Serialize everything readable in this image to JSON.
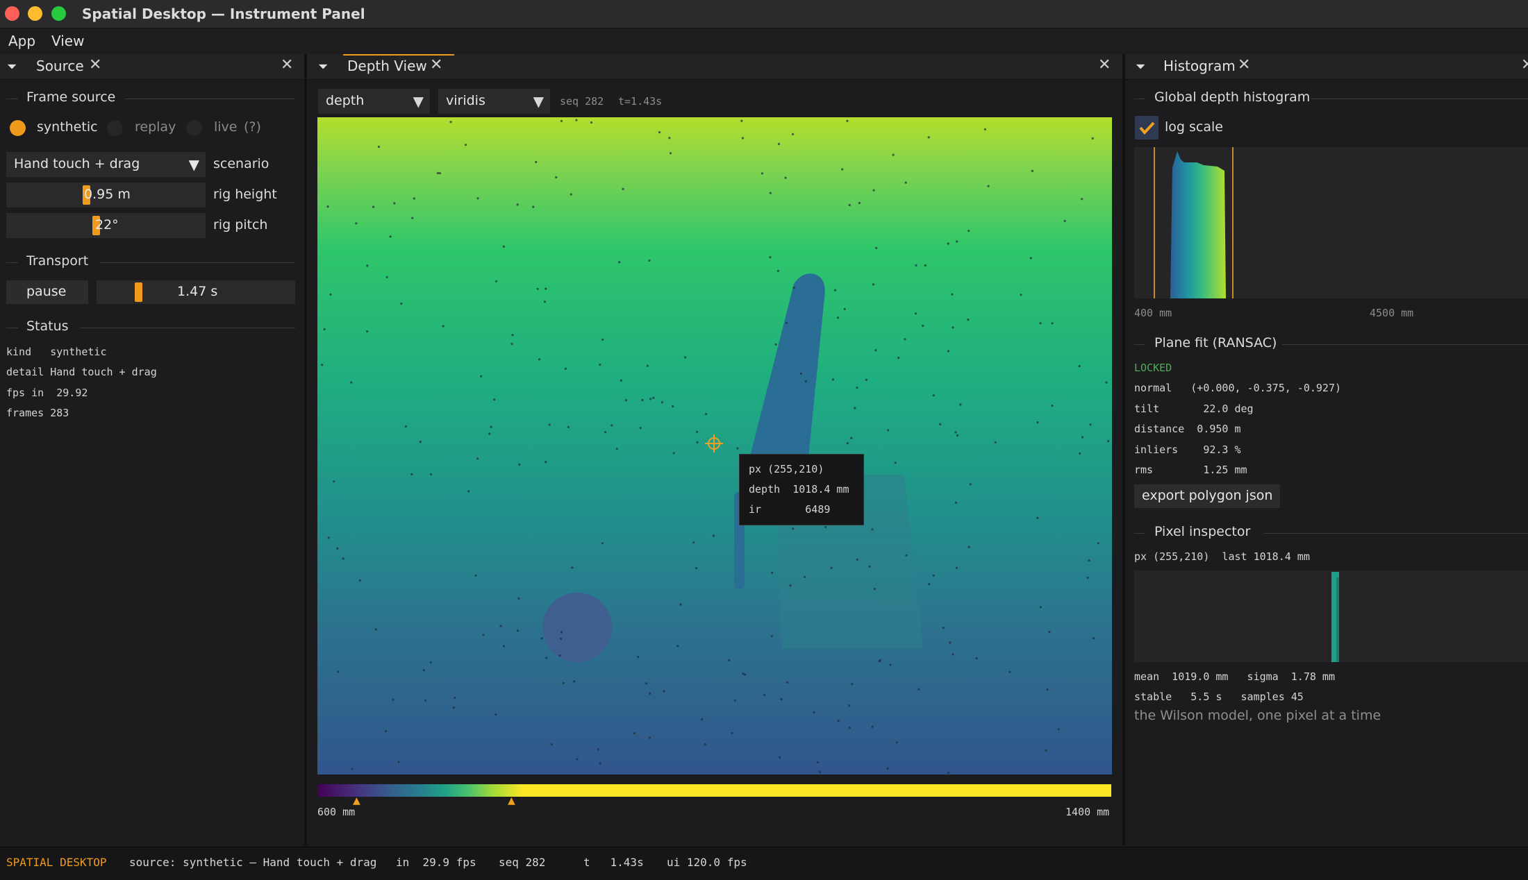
{
  "window": {
    "title": "Spatial Desktop — Instrument Panel"
  },
  "menu": [
    "App",
    "View"
  ],
  "source_panel": {
    "tab": "Source",
    "frame_source": {
      "title": "Frame source",
      "options": [
        "synthetic",
        "replay",
        "live"
      ],
      "selected": "synthetic",
      "help": "(?)"
    },
    "scenario": {
      "value": "Hand touch + drag",
      "label": "scenario"
    },
    "rig_height": {
      "value": "0.95 m",
      "label": "rig height",
      "fraction": 0.4
    },
    "rig_pitch": {
      "value": "22°",
      "label": "rig pitch",
      "fraction": 0.45
    },
    "transport": {
      "title": "Transport",
      "button": "pause",
      "time": "1.47 s",
      "fraction": 0.2
    },
    "status": {
      "title": "Status",
      "rows": [
        "kind   synthetic",
        "detail Hand touch + drag",
        "fps in  29.92",
        "frames 283"
      ]
    }
  },
  "depth_panel": {
    "tab": "Depth View",
    "mode": "depth",
    "colormap": "viridis",
    "seq": "seq 282",
    "t": "t=1.43s",
    "colorbar": {
      "min_label": "600 mm",
      "max_label": "1400 mm",
      "marker_low": 0.05,
      "marker_high": 0.245
    },
    "tooltip": {
      "px": "px (255,210)",
      "depth": "depth  1018.4 mm",
      "ir": "ir       6489"
    }
  },
  "histogram_panel": {
    "tab": "Histogram",
    "global": {
      "title": "Global depth histogram",
      "log_scale_label": "log scale",
      "log_scale": true,
      "axis_min": "400 mm",
      "axis_max": "4500 mm"
    },
    "plane_fit": {
      "title": "Plane fit (RANSAC)",
      "state": "LOCKED",
      "rows": [
        "normal   (+0.000, -0.375, -0.927)",
        "tilt       22.0 deg",
        "distance  0.950 m",
        "inliers    92.3 %",
        "rms        1.25 mm"
      ],
      "export_button": "export polygon json"
    },
    "pixel_inspector": {
      "title": "Pixel inspector",
      "header": "px (255,210)  last 1018.4 mm",
      "stats1": "mean  1019.0 mm   sigma  1.78 mm",
      "stats2": "stable   5.5 s   samples 45",
      "note": "the Wilson model, one pixel at a time"
    }
  },
  "statusbar": {
    "brand": "SPATIAL DESKTOP",
    "source": "source: synthetic — Hand touch + drag",
    "fps_in": "in  29.9 fps",
    "seq": "seq 282",
    "t": "t   1.43s",
    "ui": "ui 120.0 fps"
  },
  "colors": {
    "accent": "#f09a1c",
    "locked": "#4caf50",
    "bg": "#1c1c1e"
  }
}
